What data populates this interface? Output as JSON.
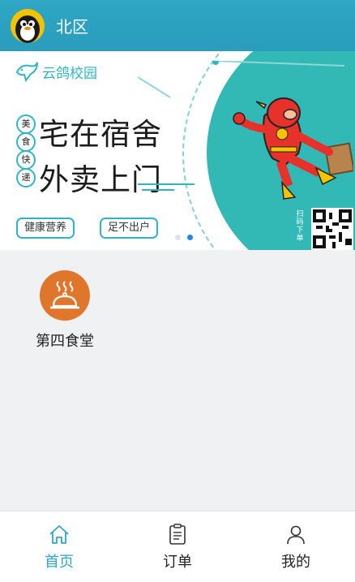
{
  "header": {
    "title": "北区"
  },
  "banner": {
    "brand": "云鸽校园",
    "headline_1": "宅在宿舍",
    "headline_2": "外卖上门",
    "side_chars": [
      "美",
      "食",
      "快",
      "递"
    ],
    "tags": [
      "健康营养",
      "足不出户"
    ],
    "scan_text": "扫码下单"
  },
  "stores": [
    {
      "name": "第四食堂",
      "icon": "food-cloche-icon"
    }
  ],
  "tabbar": [
    {
      "label": "首页",
      "icon": "home-icon",
      "active": true
    },
    {
      "label": "订单",
      "icon": "clipboard-icon",
      "active": false
    },
    {
      "label": "我的",
      "icon": "user-icon",
      "active": false
    }
  ],
  "colors": {
    "header": "#2ea6c4",
    "accent": "#2fa7c4",
    "store_icon_bg": "#e0762b",
    "banner_teal": "#33b9b5"
  }
}
